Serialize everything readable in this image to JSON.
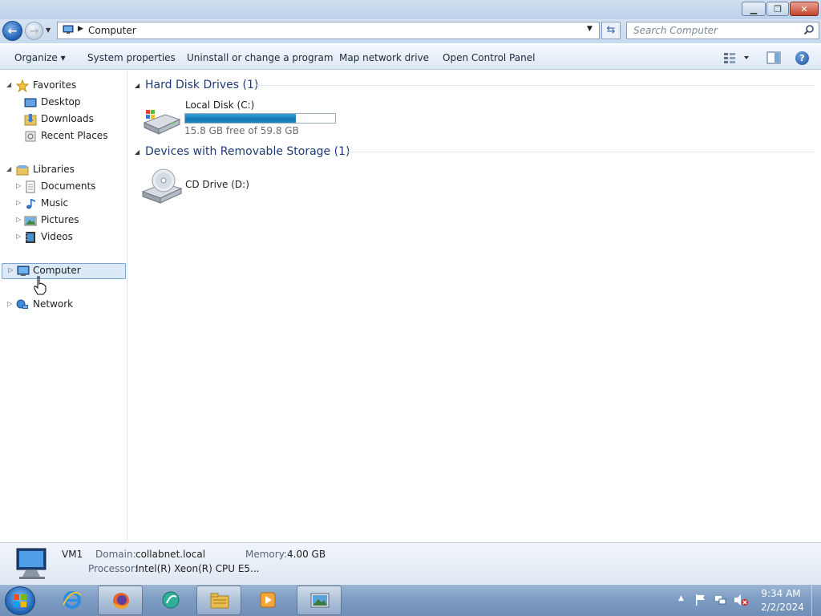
{
  "window": {
    "minimize_icon": "minimize-icon",
    "maximize_icon": "restore-icon",
    "close_icon": "close-icon"
  },
  "address": {
    "path": "Computer",
    "search_placeholder": "Search Computer"
  },
  "toolbar": {
    "organize": "Organize ▾",
    "system_properties": "System properties",
    "uninstall": "Uninstall or change a program",
    "map_drive": "Map network drive",
    "control_panel": "Open Control Panel"
  },
  "nav": {
    "favorites": "Favorites",
    "desktop": "Desktop",
    "downloads": "Downloads",
    "recent_places": "Recent Places",
    "libraries": "Libraries",
    "documents": "Documents",
    "music": "Music",
    "pictures": "Pictures",
    "videos": "Videos",
    "computer": "Computer",
    "network": "Network"
  },
  "groups": {
    "hard_disks": "Hard Disk Drives (1)",
    "removable": "Devices with Removable Storage (1)"
  },
  "drives": {
    "c_name": "Local Disk (C:)",
    "c_free": "15.8 GB free of 59.8 GB",
    "c_used_fraction": 0.736,
    "d_name": "CD Drive (D:)"
  },
  "details": {
    "computer_name": "VM1",
    "domain_label": "Domain:",
    "domain_value": "collabnet.local",
    "memory_label": "Memory:",
    "memory_value": "4.00 GB",
    "processor_label": "Processor:",
    "processor_value": "Intel(R) Xeon(R) CPU E5..."
  },
  "taskbar": {
    "time": "9:34 AM",
    "date": "2/2/2024"
  },
  "colors": {
    "drive_bar": "#1577b8",
    "selection": "#dbe9f8",
    "group_header": "#1e3b77"
  }
}
